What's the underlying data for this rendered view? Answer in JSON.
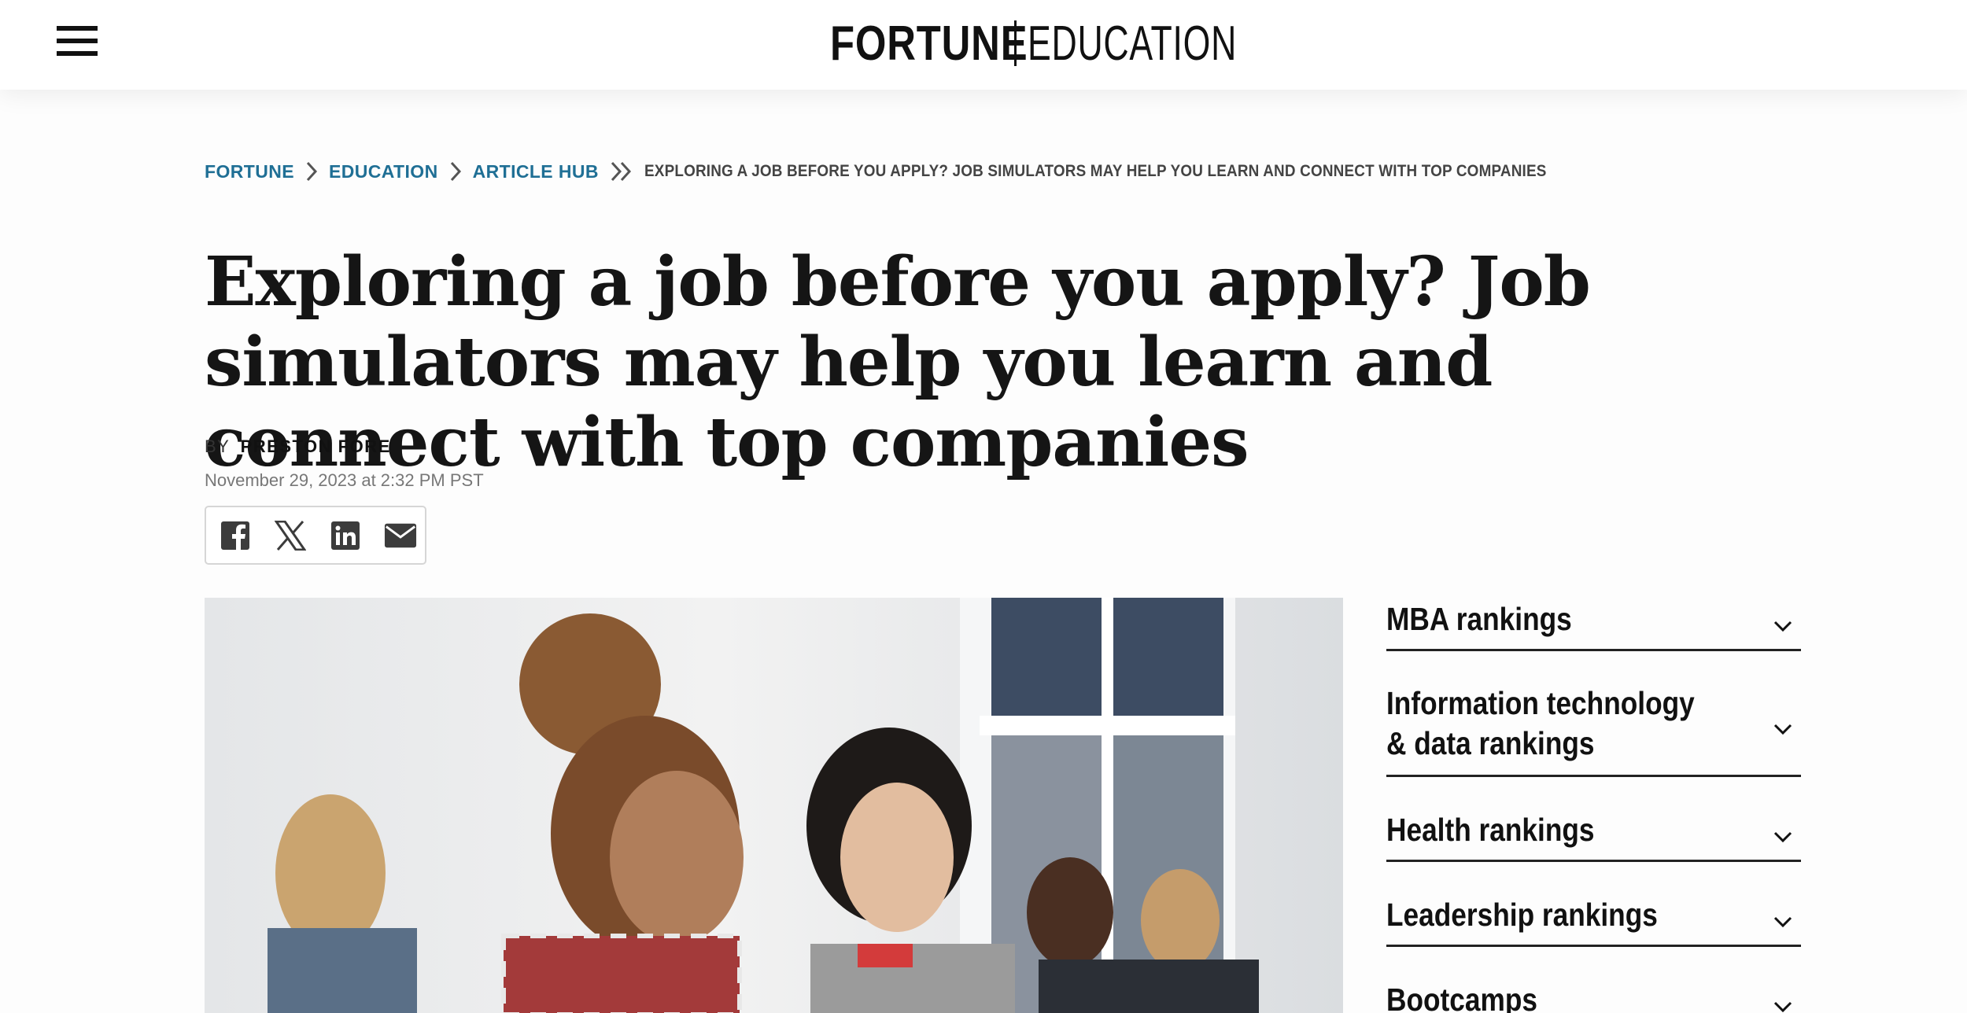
{
  "header": {
    "logo_primary": "FORTUNE",
    "logo_secondary": "EDUCATION"
  },
  "breadcrumb": {
    "items": [
      "FORTUNE",
      "EDUCATION",
      "ARTICLE HUB"
    ],
    "current": "EXPLORING A JOB BEFORE YOU APPLY? JOB SIMULATORS MAY HELP YOU LEARN AND CONNECT WITH TOP COMPANIES"
  },
  "article": {
    "title": "Exploring a job before you apply? Job simulators may help you learn and connect with top companies",
    "by_label": "BY",
    "author": "PRESTON FORE",
    "date": "November 29, 2023 at 2:32 PM PST"
  },
  "share": {
    "icons": [
      "facebook-icon",
      "x-icon",
      "linkedin-icon",
      "email-icon"
    ]
  },
  "sidebar": {
    "items": [
      {
        "label": "MBA rankings"
      },
      {
        "label": "Information technology & data rankings"
      },
      {
        "label": "Health rankings"
      },
      {
        "label": "Leadership rankings"
      },
      {
        "label": "Bootcamps"
      }
    ]
  },
  "colors": {
    "link": "#1f6f95",
    "text": "#111111",
    "muted": "#777777"
  }
}
